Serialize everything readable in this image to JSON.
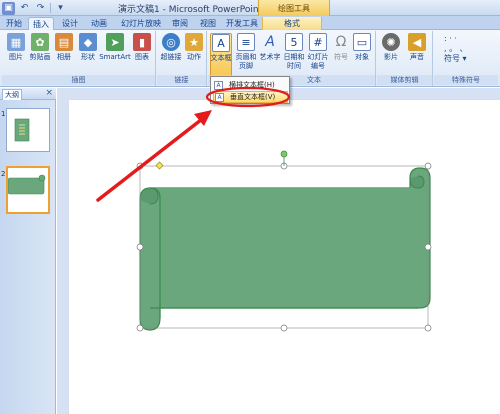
{
  "titlebar": {
    "doc_title": "演示文稿1 - Microsoft PowerPoint",
    "context_tool": "绘图工具",
    "qat": {
      "save_icon": "save-icon",
      "undo_icon": "undo-icon",
      "redo_icon": "redo-icon"
    }
  },
  "tabs": [
    {
      "label": "开始"
    },
    {
      "label": "插入"
    },
    {
      "label": "设计"
    },
    {
      "label": "动画"
    },
    {
      "label": "幻灯片放映"
    },
    {
      "label": "审阅"
    },
    {
      "label": "视图"
    },
    {
      "label": "开发工具"
    },
    {
      "label": "格式"
    }
  ],
  "ribbon": {
    "illustrations": {
      "label": "插图",
      "buttons": [
        {
          "label": "图片"
        },
        {
          "label": "剪贴画"
        },
        {
          "label": "相册"
        },
        {
          "label": "形状"
        },
        {
          "label": "SmartArt"
        },
        {
          "label": "图表"
        }
      ]
    },
    "links": {
      "label": "链接",
      "buttons": [
        {
          "label": "超链接"
        },
        {
          "label": "动作"
        }
      ]
    },
    "text": {
      "label": "文本",
      "buttons": [
        {
          "label": "文本框"
        },
        {
          "label": "页眉和页脚"
        },
        {
          "label": "艺术字"
        },
        {
          "label": "日期和时间"
        },
        {
          "label": "幻灯片编号"
        },
        {
          "label": "符号"
        },
        {
          "label": "对象"
        }
      ]
    },
    "media": {
      "label": "媒体剪辑",
      "buttons": [
        {
          "label": "影片"
        },
        {
          "label": "声音"
        }
      ]
    },
    "special": {
      "label": "特殊符号",
      "rows": [
        ": · ·",
        ", 。 、",
        "符号 ▾"
      ]
    }
  },
  "textbox_menu": {
    "items": [
      {
        "label": "横排文本框(H)"
      },
      {
        "label": "垂直文本框(V)"
      }
    ]
  },
  "outline_pane": {
    "tab_label": "大纲",
    "close": "×",
    "slide_numbers": [
      "1",
      "2"
    ]
  },
  "colors": {
    "scroll_fill": "#6aa77d",
    "scroll_stroke": "#3a8a4c",
    "annotation": "#e31b1b",
    "ribbon_accent": "#f7c752"
  }
}
